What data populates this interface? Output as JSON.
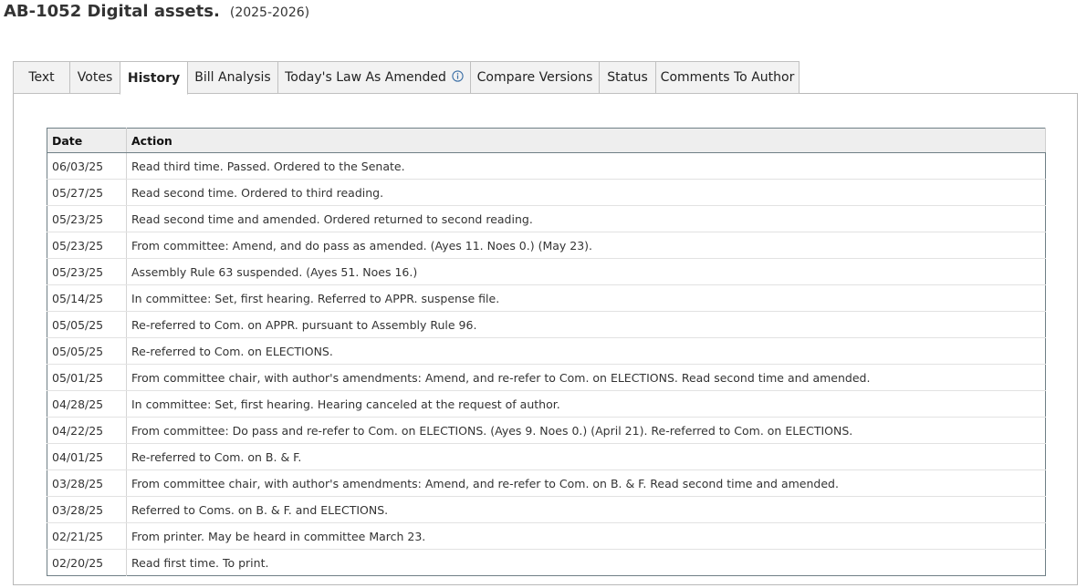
{
  "bill": {
    "title": "AB-1052 Digital assets.",
    "session": "(2025-2026)"
  },
  "tabs": [
    {
      "label": "Text",
      "active": false
    },
    {
      "label": "Votes",
      "active": false
    },
    {
      "label": "History",
      "active": true
    },
    {
      "label": "Bill Analysis",
      "active": false
    },
    {
      "label": "Today's Law As Amended",
      "active": false,
      "icon": "info-icon"
    },
    {
      "label": "Compare Versions",
      "active": false
    },
    {
      "label": "Status",
      "active": false
    },
    {
      "label": "Comments To Author",
      "active": false
    }
  ],
  "history": {
    "columns": {
      "date": "Date",
      "action": "Action"
    },
    "rows": [
      {
        "date": "06/03/25",
        "action": "Read third time. Passed. Ordered to the Senate."
      },
      {
        "date": "05/27/25",
        "action": "Read second time. Ordered to third reading."
      },
      {
        "date": "05/23/25",
        "action": "Read second time and amended. Ordered returned to second reading."
      },
      {
        "date": "05/23/25",
        "action": "From committee: Amend, and do pass as amended. (Ayes 11. Noes 0.) (May 23)."
      },
      {
        "date": "05/23/25",
        "action": "Assembly Rule 63 suspended. (Ayes 51. Noes 16.)"
      },
      {
        "date": "05/14/25",
        "action": "In committee: Set, first hearing. Referred to APPR. suspense file."
      },
      {
        "date": "05/05/25",
        "action": "Re-referred to Com. on APPR. pursuant to Assembly Rule 96."
      },
      {
        "date": "05/05/25",
        "action": "Re-referred to Com. on ELECTIONS."
      },
      {
        "date": "05/01/25",
        "action": "From committee chair, with author's amendments: Amend, and re-refer to Com. on ELECTIONS. Read second time and amended."
      },
      {
        "date": "04/28/25",
        "action": "In committee: Set, first hearing. Hearing canceled at the request of author."
      },
      {
        "date": "04/22/25",
        "action": "From committee: Do pass and re-refer to Com. on ELECTIONS. (Ayes 9. Noes 0.) (April 21). Re-referred to Com. on ELECTIONS."
      },
      {
        "date": "04/01/25",
        "action": "Re-referred to Com. on B. & F."
      },
      {
        "date": "03/28/25",
        "action": "From committee chair, with author's amendments: Amend, and re-refer to Com. on B. & F. Read second time and amended."
      },
      {
        "date": "03/28/25",
        "action": "Referred to Coms. on B. & F. and ELECTIONS."
      },
      {
        "date": "02/21/25",
        "action": "From printer. May be heard in committee March 23."
      },
      {
        "date": "02/20/25",
        "action": "Read first time. To print."
      }
    ]
  },
  "colors": {
    "tab_background": "#f2f2f2",
    "header_background": "#eeeeee",
    "table_border": "#6f7f86",
    "info_icon": "#3a6ea5"
  }
}
